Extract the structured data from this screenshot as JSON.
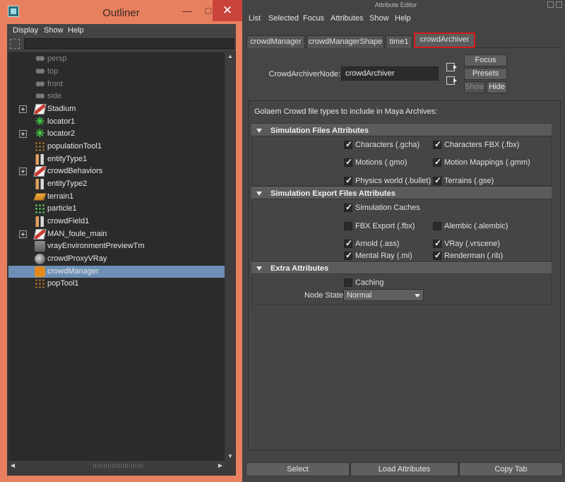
{
  "outliner": {
    "title": "Outliner",
    "menu": [
      "Display",
      "Show",
      "Help"
    ],
    "items": [
      {
        "label": "persp",
        "icon": "camera-icon"
      },
      {
        "label": "top",
        "icon": "camera-icon"
      },
      {
        "label": "front",
        "icon": "camera-icon"
      },
      {
        "label": "side",
        "icon": "camera-icon"
      },
      {
        "label": "Stadium",
        "icon": "transform-icon"
      },
      {
        "label": "locator1",
        "icon": "locator-icon"
      },
      {
        "label": "locator2",
        "icon": "locator-icon"
      },
      {
        "label": "populationTool1",
        "icon": "population-tool-icon"
      },
      {
        "label": "entityType1",
        "icon": "entity-type-icon"
      },
      {
        "label": "crowdBehaviors",
        "icon": "transform-icon"
      },
      {
        "label": "entityType2",
        "icon": "entity-type-icon"
      },
      {
        "label": "terrain1",
        "icon": "terrain-icon"
      },
      {
        "label": "particle1",
        "icon": "particle-icon"
      },
      {
        "label": "crowdField1",
        "icon": "entity-type-icon"
      },
      {
        "label": "MAN_foule_main",
        "icon": "transform-icon"
      },
      {
        "label": "vrayEnvironmentPreviewTm",
        "icon": "vray-icon"
      },
      {
        "label": "crowdProxyVRay",
        "icon": "proxy-icon"
      },
      {
        "label": "crowdManager",
        "icon": "crowd-manager-icon"
      },
      {
        "label": "popTool1",
        "icon": "population-tool-icon"
      }
    ]
  },
  "attribute_editor": {
    "title": "Attribute Editor",
    "menu": [
      "List",
      "Selected",
      "Focus",
      "Attributes",
      "Show",
      "Help"
    ],
    "tabs": [
      "crowdManager",
      "crowdManagerShape",
      "time1",
      "crowdArchiver"
    ],
    "active_tab": "crowdArchiver",
    "node_label": "CrowdArchiverNode:",
    "node_value": "crowdArchiver",
    "buttons": {
      "focus": "Focus",
      "presets": "Presets",
      "show": "Show",
      "hide": "Hide"
    },
    "frame_header": "Golaem Crowd file types to include in Maya Archives:",
    "sections": {
      "sim_files": "Simulation Files Attributes",
      "sim_export": "Simulation Export Files Attributes",
      "extra": "Extra Attributes"
    },
    "checkboxes": {
      "characters_gcha": {
        "label": "Characters (.gcha)",
        "checked": true
      },
      "characters_fbx": {
        "label": "Characters FBX (.fbx)",
        "checked": true
      },
      "motions_gmo": {
        "label": "Motions (.gmo)",
        "checked": true
      },
      "motion_mappings": {
        "label": "Motion Mappings (.gmm)",
        "checked": true
      },
      "physics_world": {
        "label": "Physics world (.bullet)",
        "checked": true
      },
      "terrains": {
        "label": "Terrains (.gse)",
        "checked": true
      },
      "simulation_caches": {
        "label": "Simulation Caches",
        "checked": true
      },
      "fbx_export": {
        "label": "FBX Export (.fbx)",
        "checked": false
      },
      "alembic": {
        "label": "Alembic (.alembic)",
        "checked": false
      },
      "arnold": {
        "label": "Arnold (.ass)",
        "checked": true
      },
      "vray": {
        "label": "VRay (.vrscene)",
        "checked": true
      },
      "mental_ray": {
        "label": "Mental Ray (.mi)",
        "checked": true
      },
      "renderman": {
        "label": "Renderman (.rib)",
        "checked": true
      },
      "caching": {
        "label": "Caching",
        "checked": false
      }
    },
    "node_state": {
      "label": "Node State",
      "value": "Normal"
    },
    "bottom_buttons": {
      "select": "Select",
      "load": "Load Attributes",
      "copy": "Copy Tab"
    }
  }
}
